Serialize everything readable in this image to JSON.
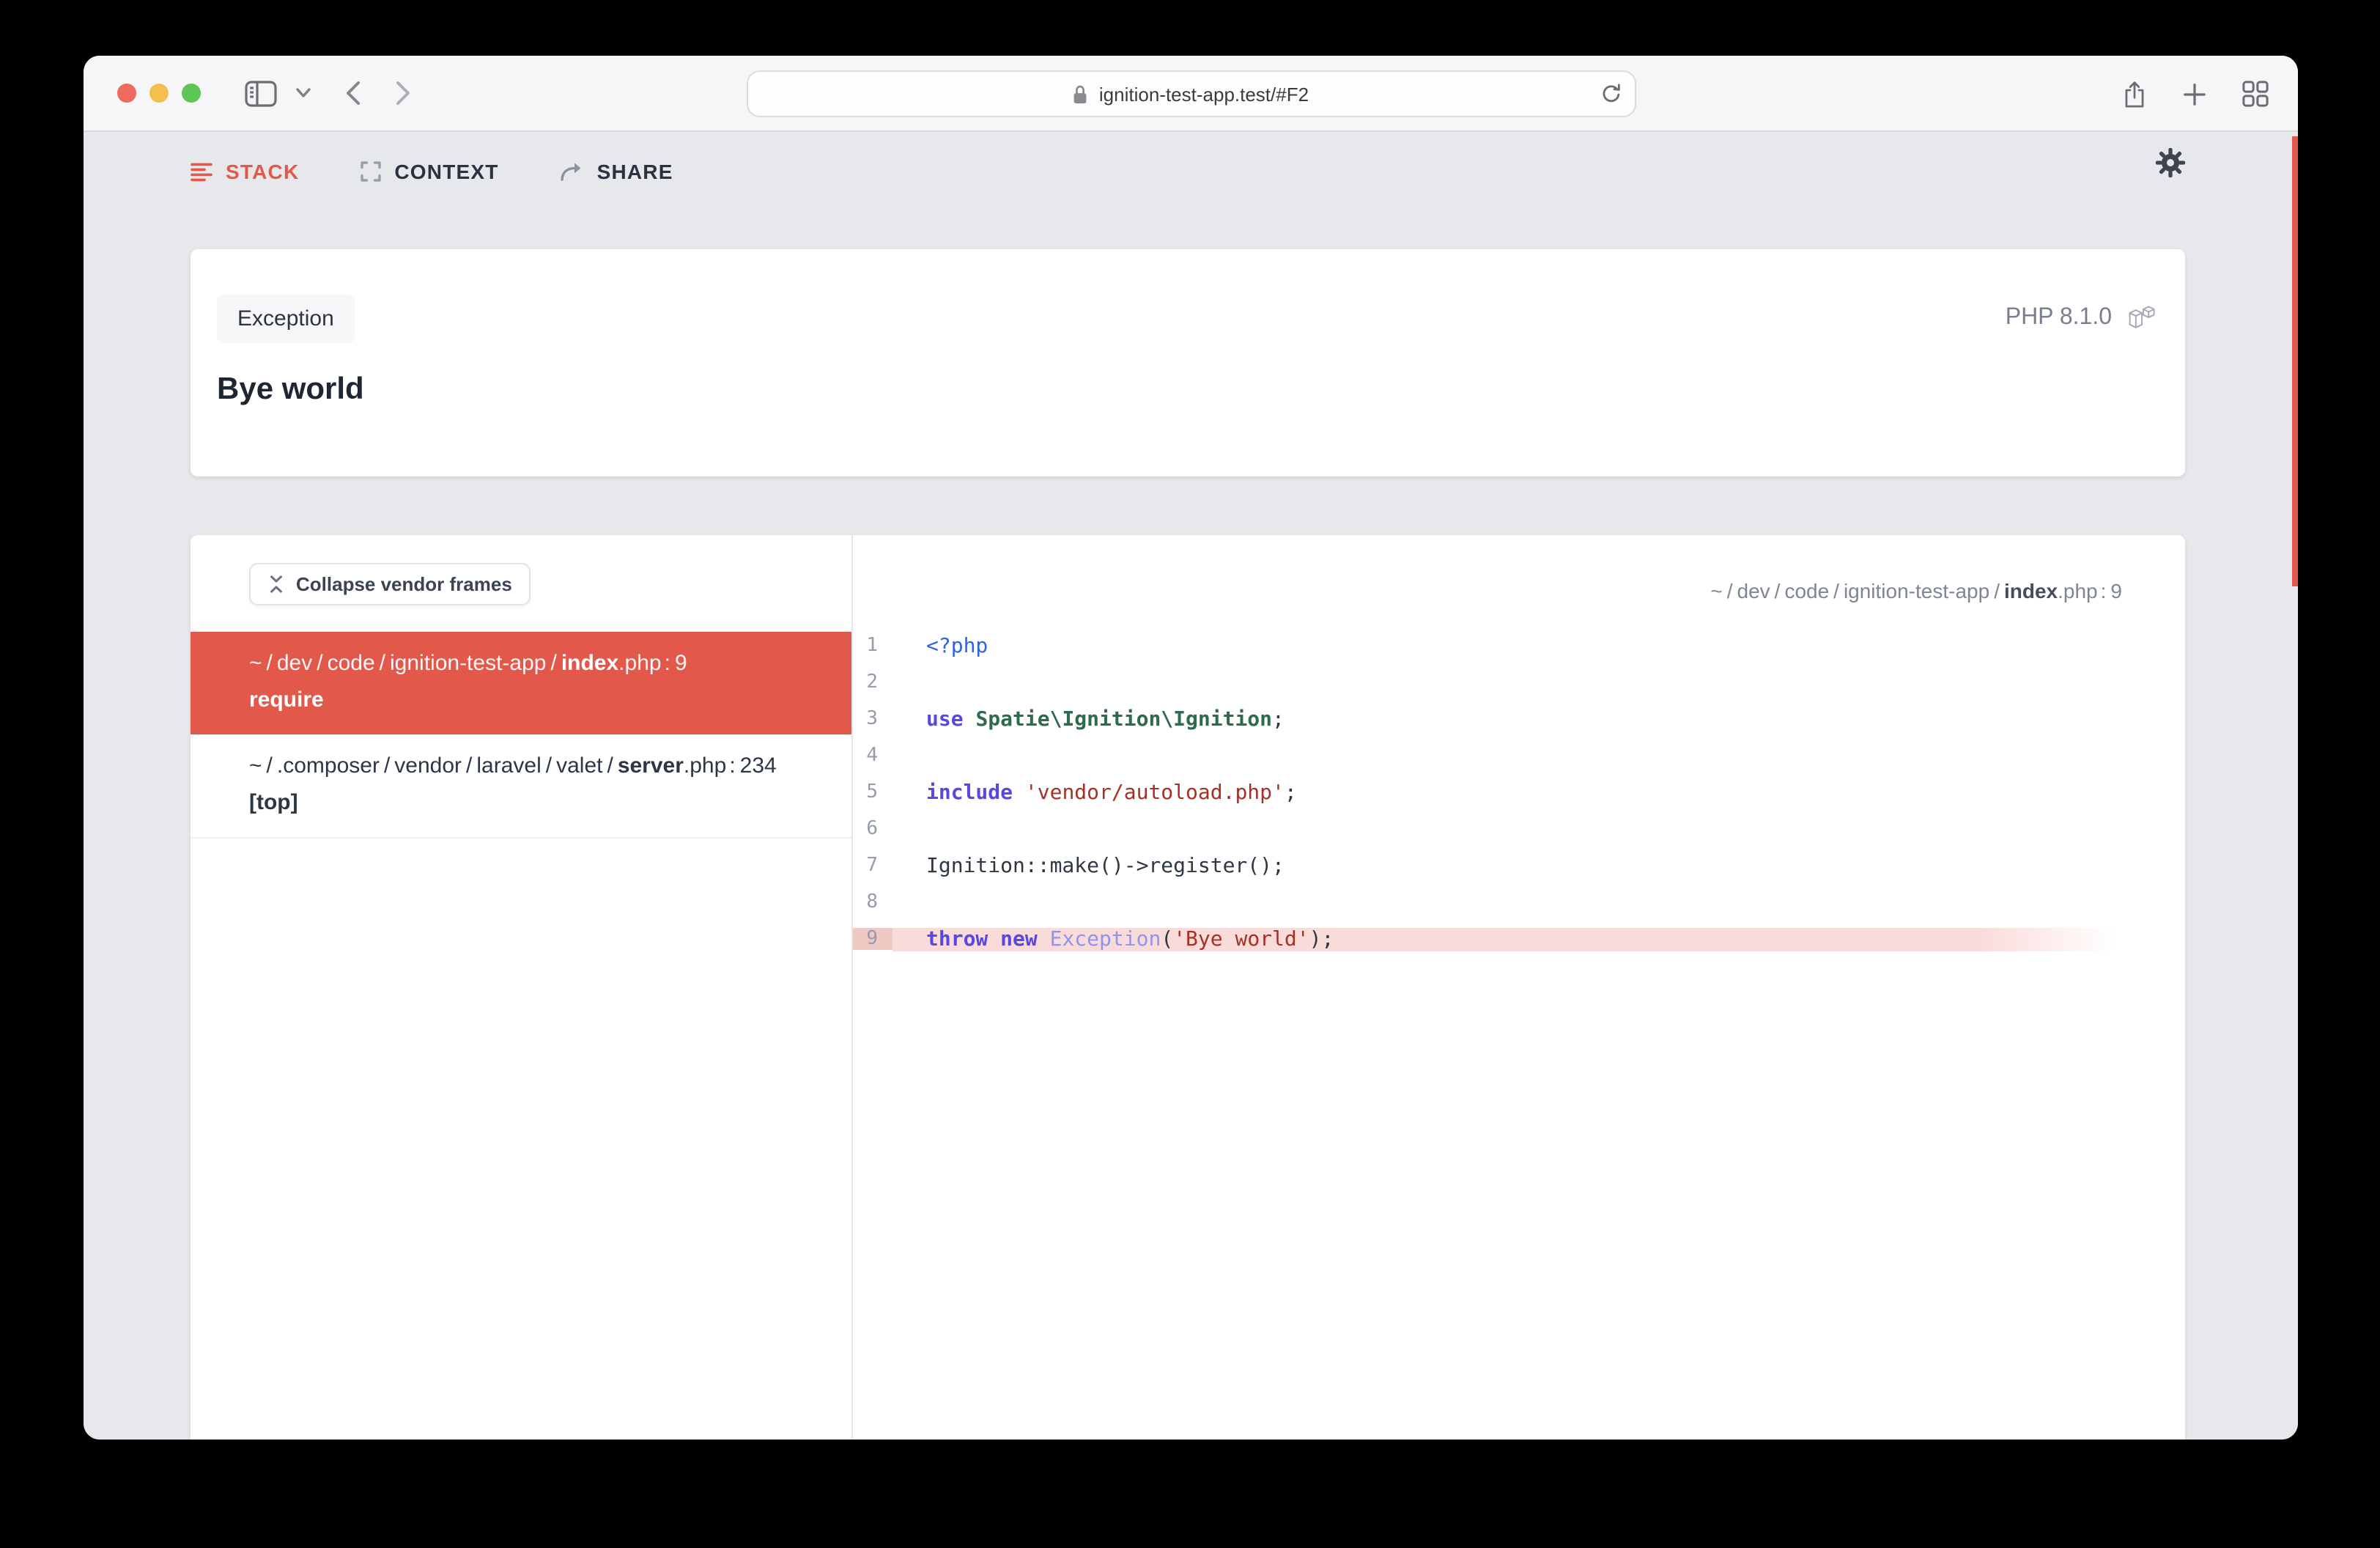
{
  "browser": {
    "url": "ignition-test-app.test/#F2",
    "traffic_lights": [
      "close",
      "minimize",
      "fullscreen"
    ],
    "toolbar_icons": [
      "sidebar-toggle-icon",
      "chevron-down-icon",
      "back-icon",
      "forward-icon",
      "lock-icon",
      "reload-icon",
      "share-icon",
      "new-tab-icon",
      "tab-overview-icon"
    ]
  },
  "nav": {
    "tabs": [
      {
        "id": "stack",
        "label": "STACK",
        "active": true,
        "icon": "stack-lines-icon"
      },
      {
        "id": "context",
        "label": "CONTEXT",
        "active": false,
        "icon": "context-brackets-icon"
      },
      {
        "id": "share",
        "label": "SHARE",
        "active": false,
        "icon": "share-arrow-icon"
      }
    ],
    "settings_icon": "gear-icon"
  },
  "exception": {
    "badge": "Exception",
    "message": "Bye world",
    "php_version": "PHP 8.1.0",
    "runtime_icon": "laravel-icon"
  },
  "stack": {
    "collapse_button": "Collapse vendor frames",
    "collapse_icon": "collapse-vertical-icon",
    "frames": [
      {
        "prefix": "~/dev/code/ignition-test-app/",
        "file": "index",
        "ext": ".php",
        "line": "9",
        "method": "require",
        "active": true
      },
      {
        "prefix": "~/.composer/vendor/laravel/valet/",
        "file": "server",
        "ext": ".php",
        "line": "234",
        "method": "[top]",
        "active": false
      }
    ]
  },
  "editor": {
    "path": {
      "prefix": "~/dev/code/ignition-test-app/",
      "file": "index",
      "ext": ".php",
      "line": "9"
    },
    "highlighted_line": 9,
    "lines": [
      {
        "n": 1,
        "tokens": [
          [
            "<?php",
            "tag"
          ]
        ]
      },
      {
        "n": 2,
        "tokens": []
      },
      {
        "n": 3,
        "tokens": [
          [
            "use ",
            "kw"
          ],
          [
            "Spatie\\Ignition\\Ignition",
            "cls"
          ],
          [
            ";",
            "pln"
          ]
        ]
      },
      {
        "n": 4,
        "tokens": []
      },
      {
        "n": 5,
        "tokens": [
          [
            "include ",
            "kw"
          ],
          [
            "'vendor/autoload.php'",
            "str"
          ],
          [
            ";",
            "pln"
          ]
        ]
      },
      {
        "n": 6,
        "tokens": []
      },
      {
        "n": 7,
        "tokens": [
          [
            "Ignition::make()->register();",
            "pln"
          ]
        ]
      },
      {
        "n": 8,
        "tokens": []
      },
      {
        "n": 9,
        "tokens": [
          [
            "throw ",
            "kw"
          ],
          [
            "new ",
            "kw"
          ],
          [
            "Exception",
            "exc"
          ],
          [
            "(",
            "pln"
          ],
          [
            "'Bye world'",
            "str"
          ],
          [
            ");",
            "pln"
          ]
        ],
        "hl": true
      }
    ]
  },
  "colors": {
    "accent_red": "#e3584c",
    "active_frame_bg": "#e2594c",
    "highlight_row": "#f9dcda",
    "highlight_gutter": "#f0c8c4",
    "token_tag": "#2c63e8",
    "token_keyword": "#5848e0",
    "token_class": "#2e6b4d",
    "token_exception": "#8e94ef",
    "token_string": "#a53125"
  }
}
